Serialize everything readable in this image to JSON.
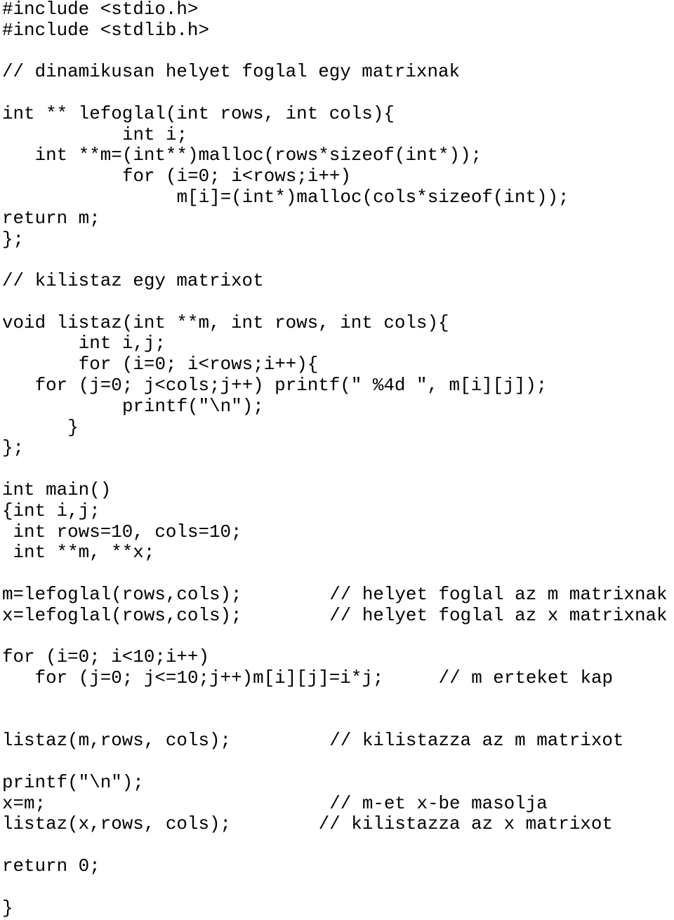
{
  "document": {
    "language": "C",
    "lines": [
      {
        "row": 0,
        "indent": 0,
        "code": "#include <stdio.h>"
      },
      {
        "row": 1,
        "indent": 0,
        "code": "#include <stdlib.h>"
      },
      {
        "row": 3,
        "indent": 0,
        "code": "// dinamikusan helyet foglal egy matrixnak"
      },
      {
        "row": 5,
        "indent": 0,
        "code": "int ** lefoglal(int rows, int cols){"
      },
      {
        "row": 6,
        "indent": 11,
        "code": "int i;"
      },
      {
        "row": 7,
        "indent": 3,
        "code": "int **m=(int**)malloc(rows*sizeof(int*));"
      },
      {
        "row": 8,
        "indent": 11,
        "code": "for (i=0; i<rows;i++)"
      },
      {
        "row": 9,
        "indent": 16,
        "code": "m[i]=(int*)malloc(cols*sizeof(int));"
      },
      {
        "row": 10,
        "indent": 0,
        "code": "return m;"
      },
      {
        "row": 11,
        "indent": 0,
        "code": "};"
      },
      {
        "row": 13,
        "indent": 0,
        "code": "// kilistaz egy matrixot"
      },
      {
        "row": 15,
        "indent": 0,
        "code": "void listaz(int **m, int rows, int cols){"
      },
      {
        "row": 16,
        "indent": 7,
        "code": "int i,j;"
      },
      {
        "row": 17,
        "indent": 7,
        "code": "for (i=0; i<rows;i++){"
      },
      {
        "row": 18,
        "indent": 3,
        "code": "for (j=0; j<cols;j++) printf(\" %4d \", m[i][j]);"
      },
      {
        "row": 19,
        "indent": 11,
        "code": "printf(\"\\n\");"
      },
      {
        "row": 20,
        "indent": 6,
        "code": "}"
      },
      {
        "row": 21,
        "indent": 0,
        "code": "};"
      },
      {
        "row": 23,
        "indent": 0,
        "code": "int main()"
      },
      {
        "row": 24,
        "indent": 0,
        "code": "{int i,j;"
      },
      {
        "row": 25,
        "indent": 1,
        "code": "int rows=10, cols=10;"
      },
      {
        "row": 26,
        "indent": 1,
        "code": "int **m, **x;"
      },
      {
        "row": 28,
        "indent": 0,
        "code": "m=lefoglal(rows,cols);",
        "comment": "// helyet foglal az m matrixnak",
        "comment_col": 30
      },
      {
        "row": 29,
        "indent": 0,
        "code": "x=lefoglal(rows,cols);",
        "comment": "// helyet foglal az x matrixnak",
        "comment_col": 30
      },
      {
        "row": 31,
        "indent": 0,
        "code": "for (i=0; i<10;i++)"
      },
      {
        "row": 32,
        "indent": 3,
        "code": "for (j=0; j<=10;j++)m[i][j]=i*j;",
        "comment": "// m erteket kap",
        "comment_col": 40
      },
      {
        "row": 35,
        "indent": 0,
        "code": "listaz(m,rows, cols);",
        "comment": "// kilistazza az m matrixot",
        "comment_col": 30
      },
      {
        "row": 37,
        "indent": 0,
        "code": "printf(\"\\n\");"
      },
      {
        "row": 38,
        "indent": 0,
        "code": "x=m;",
        "comment": "// m-et x-be masolja",
        "comment_col": 30
      },
      {
        "row": 39,
        "indent": 0,
        "code": "listaz(x,rows, cols);",
        "comment": "// kilistazza az x matrixot",
        "comment_col": 29
      },
      {
        "row": 41,
        "indent": 0,
        "code": "return 0;"
      },
      {
        "row": 43,
        "indent": 0,
        "code": "}"
      }
    ]
  }
}
